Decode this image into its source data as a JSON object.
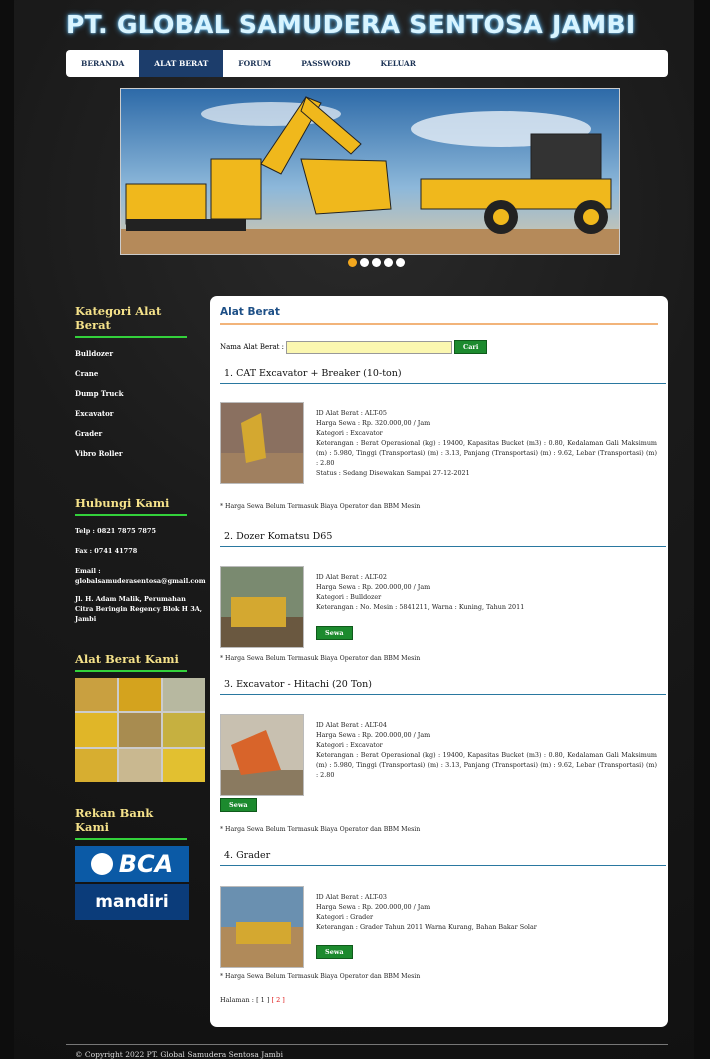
{
  "header": {
    "title": "PT. GLOBAL SAMUDERA SENTOSA JAMBI"
  },
  "nav": {
    "items": [
      "BERANDA",
      "ALAT BERAT",
      "FORUM",
      "PASSWORD",
      "KELUAR"
    ],
    "active": "ALAT BERAT"
  },
  "slider": {
    "slide_count": 5,
    "active_index": 0
  },
  "sidebar": {
    "kategori_title": "Kategori Alat Berat",
    "kategori": [
      "Bulldozer",
      "Crane",
      "Dump Truck",
      "Excavator",
      "Grader",
      "Vibro Roller"
    ],
    "kontak_title": "Hubungi Kami",
    "telp": "Telp : 0821 7875 7875",
    "fax": "Fax : 0741 41778",
    "email_label": "Email :",
    "email": "globalsamuderasentosa@gmail.com",
    "alamat": "Jl. H. Adam Malik, Perumahan Citra Beringin Regency Blok H 3A, Jambi",
    "alat_title": "Alat Berat Kami",
    "bank_title": "Rekan Bank Kami",
    "bank_logos": [
      "BCA",
      "mandiri"
    ]
  },
  "main": {
    "title": "Alat Berat",
    "search_label": "Nama Alat Berat :",
    "search_value": "",
    "search_button": "Cari",
    "rent_button": "Sewa",
    "note": "* Harga Sewa Belum Termasuk Biaya Operator dan BBM Mesin",
    "items": [
      {
        "heading": "1. CAT Excavator + Breaker (10-ton)",
        "id": "ID Alat Berat : ALT-05",
        "harga": "Harga Sewa : Rp. 320.000,00 / Jam",
        "kategori": "Kategori : Excavator",
        "keterangan": "Keterangan : Berat Operasional (kg) : 19400, Kapasitas Bucket (m3) : 0.80, Kedalaman Gali Maksimum (m) : 5.980, Tinggi (Transportasi) (m) : 3.13, Panjang (Transportasi) (m) : 9.62, Lebar (Transportasi) (m) : 2.80",
        "status": "Status : Sedang Disewakan Sampai 27-12-2021"
      },
      {
        "heading": "2. Dozer Komatsu D65",
        "id": "ID Alat Berat : ALT-02",
        "harga": "Harga Sewa : Rp. 200.000,00 / Jam",
        "kategori": "Kategori : Bulldozer",
        "keterangan": "Keterangan : No. Mesin : 5841211, Warna : Kuning, Tahun 2011"
      },
      {
        "heading": "3. Excavator - Hitachi (20 Ton)",
        "id": "ID Alat Berat : ALT-04",
        "harga": "Harga Sewa : Rp. 200.000,00 / Jam",
        "kategori": "Kategori : Excavator",
        "keterangan": "Keterangan : Berat Operasional (kg) : 19400, Kapasitas Bucket (m3) : 0.80, Kedalaman Gali Maksimum (m) : 5.980, Tinggi (Transportasi) (m) : 3.13, Panjang (Transportasi) (m) : 9.62, Lebar (Transportasi) (m) : 2.80"
      },
      {
        "heading": "4. Grader",
        "id": "ID Alat Berat : ALT-03",
        "harga": "Harga Sewa : Rp. 200.000,00 / Jam",
        "kategori": "Kategori : Grader",
        "keterangan": "Keterangan : Grader Tahun 2011 Warna Kurang, Bahan Bakar Solar"
      }
    ],
    "pagination": {
      "label": "Halaman :",
      "current": "[ 1 ]",
      "next": "[ 2 ]"
    }
  },
  "footer": {
    "text": "© Copyright 2022 PT. Global Samudera Sentosa Jambi"
  },
  "colors": {
    "nav_active": "#1c3d6b",
    "button": "#1c8a2e",
    "sidebar_heading": "#f5e28a",
    "sidebar_underline": "#33d13b"
  }
}
